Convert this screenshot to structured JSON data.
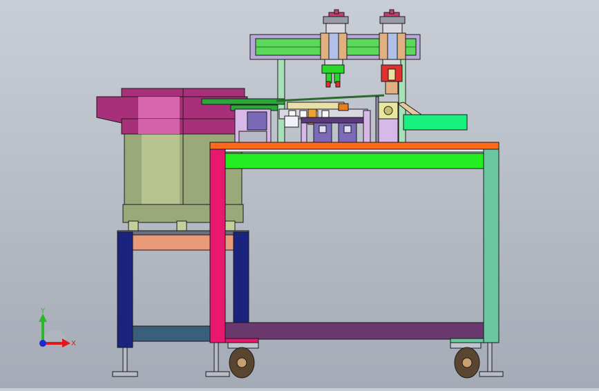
{
  "view": {
    "background_top": "#c9ced6",
    "background_bottom": "#a5abb6"
  },
  "triad": {
    "x_label": "X",
    "y_label": "Y",
    "x_color": "#e01818",
    "y_color": "#2ab82a",
    "z_color": "#1a2ad6"
  },
  "colors": {
    "bowl_top": "#a8307a",
    "bowl_highlight": "#e070b8",
    "bowl_body": "#9aa87a",
    "bowl_body_light": "#c4d09a",
    "small_stand_leg": "#1a237e",
    "small_stand_brace": "#e89a78",
    "small_stand_rail": "#3a5f7a",
    "table_top": "#ff6a1a",
    "table_apron": "#22ee22",
    "table_leg_left": "#e8186e",
    "table_leg_right": "#6ac8a0",
    "table_bottom_rail": "#6a3a6e",
    "gantry_frame": "#a8e0b8",
    "gantry_beam": "#5ad85a",
    "gantry_beam_frame": "#b8a8d8",
    "carriage": "#e0b080",
    "gripper_green": "#2ad82a",
    "gripper_red": "#e03030",
    "chute": "#18f080",
    "feeder_rail": "#2aa83a",
    "block_purple": "#7a6ab8",
    "block_lilac": "#d8b8e8",
    "motor_box": "#e8e8a0",
    "caster_wheel": "#5a4530",
    "foot": "#b8bcc6",
    "outline": "#1a1a1a"
  }
}
